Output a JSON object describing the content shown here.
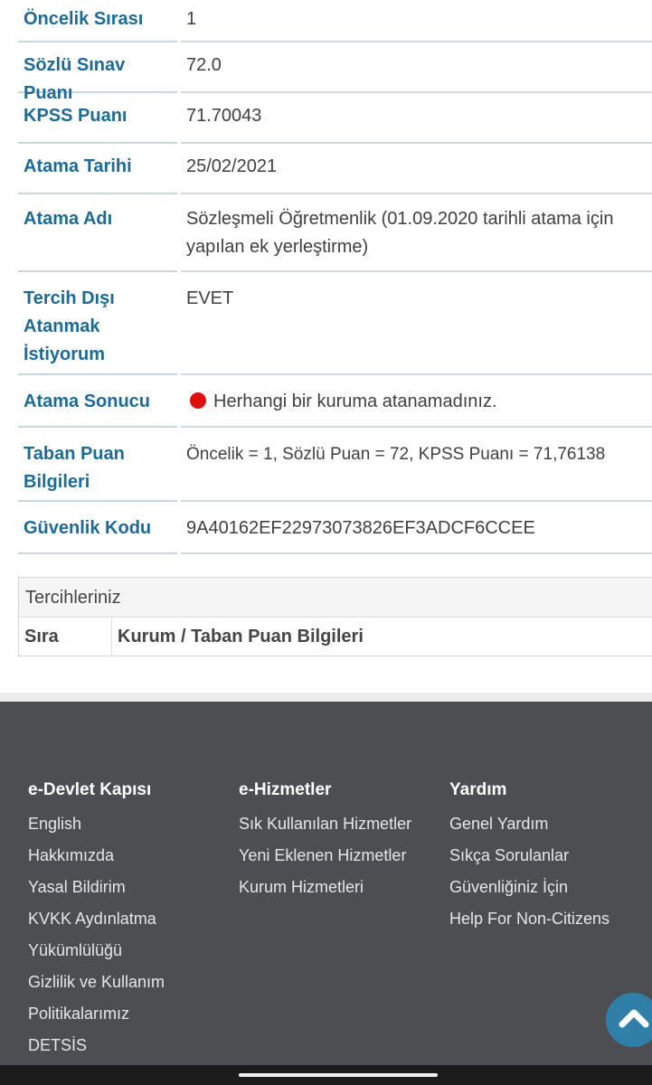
{
  "info_rows": [
    {
      "label": "Öncelik Sırası",
      "value": "1"
    },
    {
      "label": "Sözlü Sınav Puanı",
      "value": "72.0"
    },
    {
      "label": "KPSS Puanı",
      "value": "71.70043"
    },
    {
      "label": "Atama Tarihi",
      "value": "25/02/2021"
    },
    {
      "label": "Atama Adı",
      "value": "Sözleşmeli Öğretmenlik (01.09.2020 tarihli atama için yapılan ek yerleştirme)"
    },
    {
      "label": "Tercih Dışı Atanmak İstiyorum",
      "value": "EVET"
    },
    {
      "label": "Atama Sonucu",
      "value": "Herhangi bir kuruma atanamadınız."
    },
    {
      "label": "Taban Puan Bilgileri",
      "value": "Öncelik = 1, Sözlü Puan = 72, KPSS Puanı = 71,76138"
    },
    {
      "label": "Güvenlik Kodu",
      "value": "9A40162EF22973073826EF3ADCF6CCEE"
    }
  ],
  "preferences": {
    "title": "Tercihleriniz",
    "col_order": "Sıra",
    "col_institution": "Kurum / Taban Puan Bilgileri"
  },
  "footer": {
    "col1": {
      "title": "e-Devlet Kapısı",
      "links": [
        "English",
        "Hakkımızda",
        "Yasal Bildirim",
        "KVKK Aydınlatma",
        "Yükümlülüğü",
        "Gizlilik ve Kullanım",
        "Politikalarımız",
        "DETSİS"
      ]
    },
    "col2": {
      "title": "e-Hizmetler",
      "links": [
        "Sık Kullanılan Hizmetler",
        "Yeni Eklenen Hizmetler",
        "Kurum Hizmetleri"
      ]
    },
    "col3": {
      "title": "Yardım",
      "links": [
        "Genel Yardım",
        "Sıkça Sorulanlar",
        "Güvenliğiniz İçin",
        "Help For Non-Citizens"
      ]
    }
  },
  "colors": {
    "label": "#1e6a96",
    "status_error": "#e10e0e",
    "footer_bg": "#4c4e51",
    "scroll_button": "#2f7fa9"
  },
  "icons": {
    "status": "red-dot-icon",
    "scroll_top": "chevron-up-icon"
  }
}
